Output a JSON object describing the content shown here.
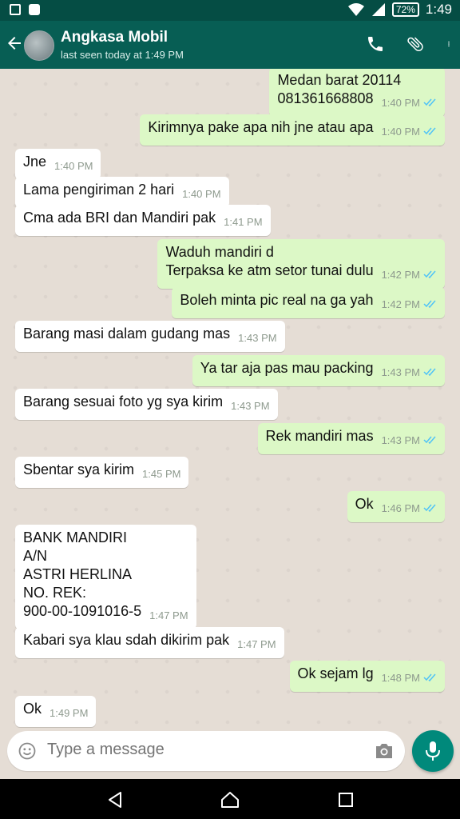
{
  "status_bar": {
    "battery": "72%",
    "time": "1:49"
  },
  "header": {
    "contact_name": "Angkasa Mobil",
    "last_seen": "last seen today at 1:49 PM"
  },
  "messages": [
    {
      "dir": "out",
      "text": "Medan barat 20114\n081361668808",
      "time": "1:40 PM"
    },
    {
      "dir": "out",
      "text": "Kirimnya pake apa nih jne atau apa",
      "time": "1:40 PM"
    },
    {
      "dir": "in",
      "text": "Jne",
      "time": "1:40 PM"
    },
    {
      "dir": "in",
      "text": "Lama pengiriman 2 hari",
      "time": "1:40 PM"
    },
    {
      "dir": "in",
      "text": "Cma ada BRI dan Mandiri pak",
      "time": "1:41 PM"
    },
    {
      "dir": "out",
      "text": "Waduh mandiri d\nTerpaksa ke atm setor tunai dulu",
      "time": "1:42 PM"
    },
    {
      "dir": "out",
      "text": "Boleh minta pic real na ga yah",
      "time": "1:42 PM"
    },
    {
      "dir": "in",
      "text": "Barang masi dalam gudang mas",
      "time": "1:43 PM"
    },
    {
      "dir": "out",
      "text": "Ya tar aja pas mau packing",
      "time": "1:43 PM"
    },
    {
      "dir": "in",
      "text": "Barang sesuai foto yg sya kirim",
      "time": "1:43 PM"
    },
    {
      "dir": "out",
      "text": "Rek mandiri mas",
      "time": "1:43 PM"
    },
    {
      "dir": "in",
      "text": "Sbentar sya kirim",
      "time": "1:45 PM"
    },
    {
      "dir": "out",
      "text": "Ok",
      "time": "1:46 PM"
    },
    {
      "dir": "in",
      "text": "BANK MANDIRI\nA/N\nASTRI HERLINA\nNO. REK:\n900-00-1091016-5",
      "time": "1:47 PM"
    },
    {
      "dir": "in",
      "text": "Kabari sya klau sdah dikirim pak",
      "time": "1:47 PM"
    },
    {
      "dir": "out",
      "text": "Ok sejam lg",
      "time": "1:48 PM"
    },
    {
      "dir": "in",
      "text": "Ok",
      "time": "1:49 PM"
    }
  ],
  "input": {
    "placeholder": "Type a message"
  },
  "colors": {
    "header": "#075e54",
    "status_bar": "#054d44",
    "outgoing_bubble": "#dcf8c6",
    "incoming_bubble": "#ffffff",
    "read_ticks": "#4fc3f7",
    "mic_button": "#00897b"
  },
  "icons": [
    "back-arrow-icon",
    "call-icon",
    "attach-icon",
    "more-icon",
    "emoji-icon",
    "camera-icon",
    "mic-icon",
    "nav-back-icon",
    "nav-home-icon",
    "nav-recent-icon"
  ]
}
